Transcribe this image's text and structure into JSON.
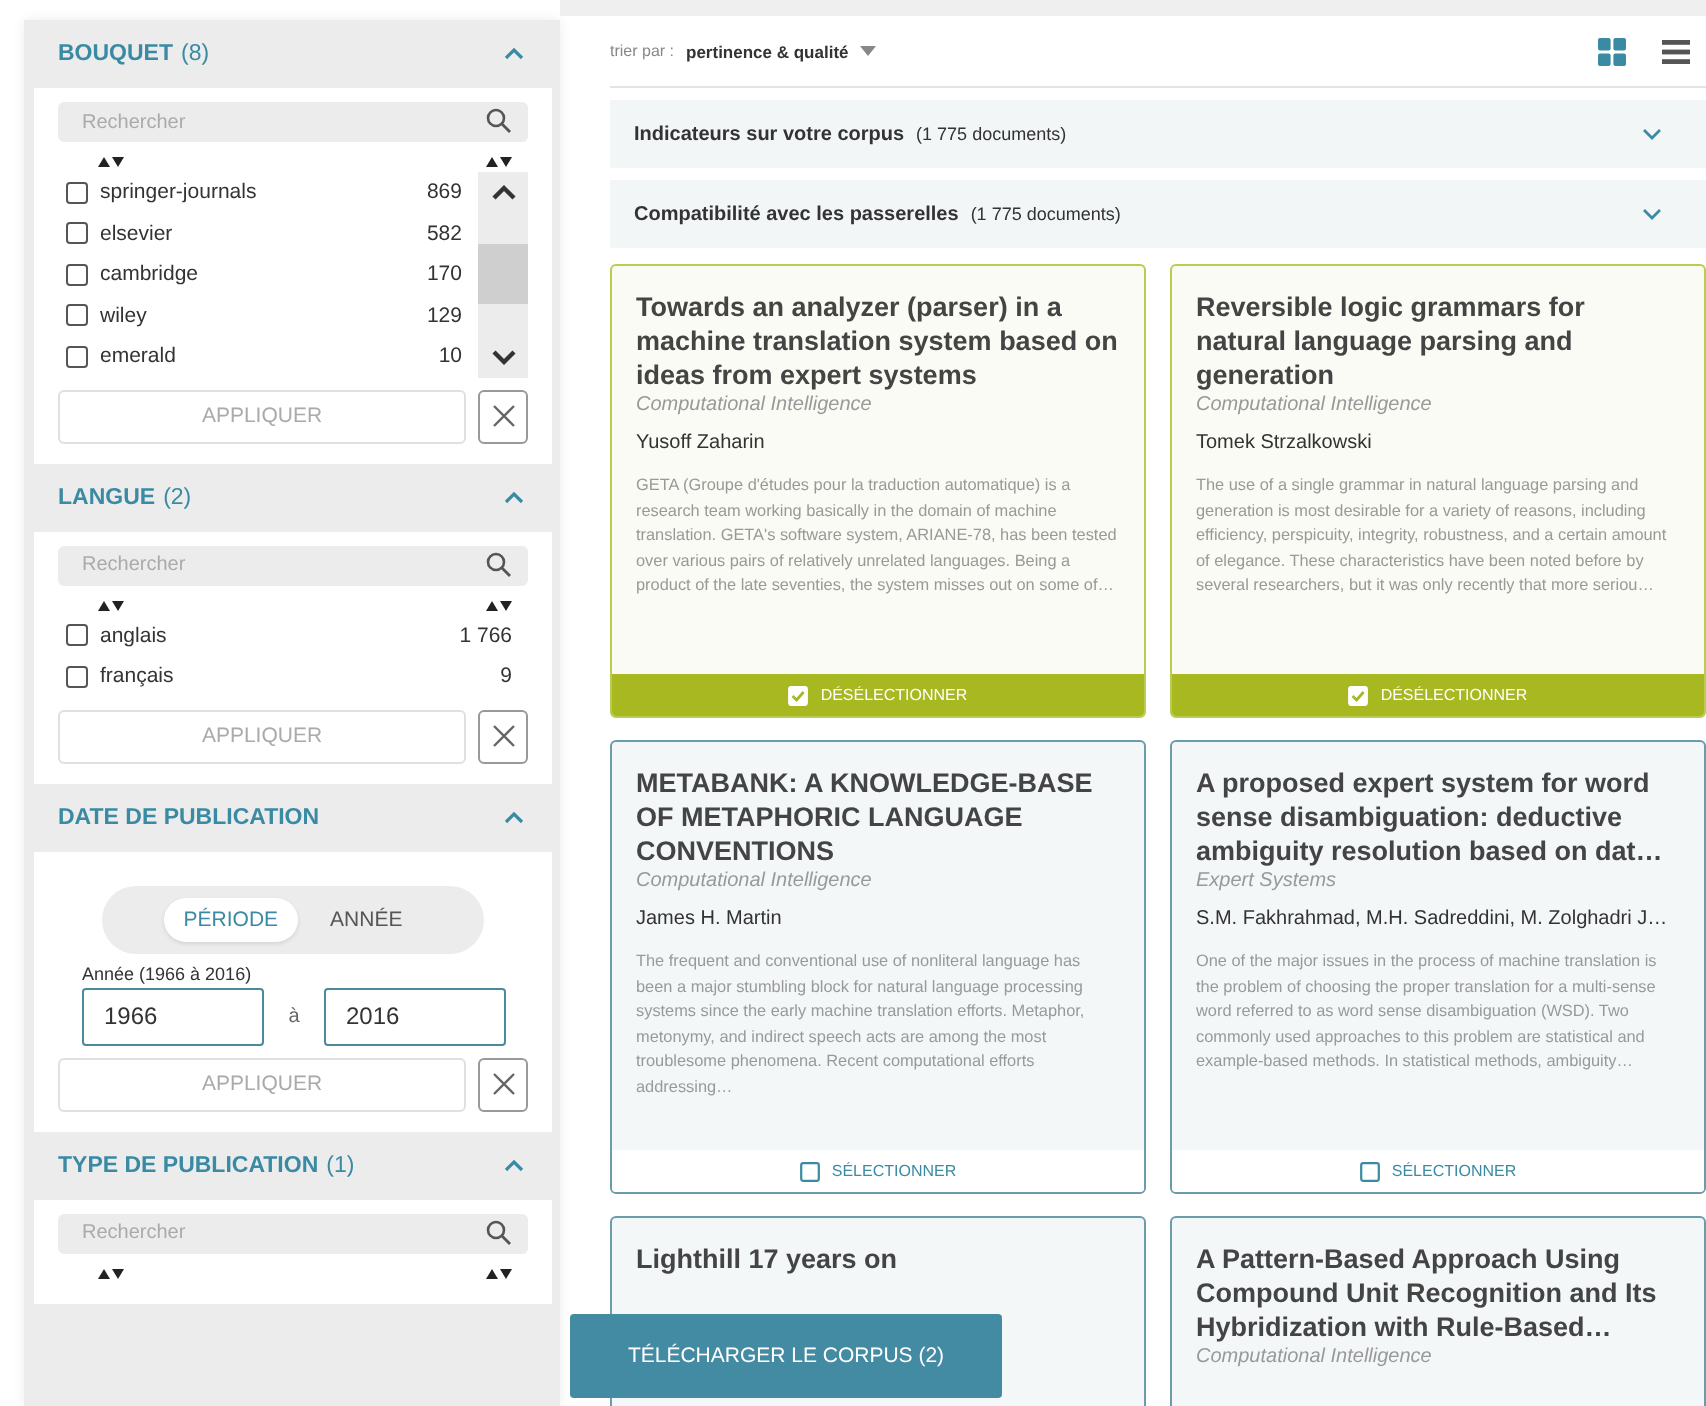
{
  "sort": {
    "label": "trier par :",
    "value": "pertinence & qualité"
  },
  "view_toggle": [
    {
      "kind": "grid",
      "selected": true
    },
    {
      "kind": "list",
      "selected": false
    }
  ],
  "panels": [
    {
      "title": "Indicateurs sur votre corpus",
      "count": "(1 775 documents)",
      "expanded": false
    },
    {
      "title": "Compatibilité avec les passerelles",
      "count": "(1 775 documents)",
      "expanded": false
    }
  ],
  "facets": [
    {
      "kind": "list",
      "title": "BOUQUET",
      "count": "(8)",
      "expanded": true,
      "search_placeholder": "Rechercher",
      "apply": "APPLIQUER",
      "items": [
        {
          "label": "springer-journals",
          "count": "869",
          "checked": false
        },
        {
          "label": "elsevier",
          "count": "582",
          "checked": false
        },
        {
          "label": "cambridge",
          "count": "170",
          "checked": false
        },
        {
          "label": "wiley",
          "count": "129",
          "checked": false
        },
        {
          "label": "emerald",
          "count": "10",
          "checked": false
        }
      ]
    },
    {
      "kind": "list",
      "title": "LANGUE",
      "count": "(2)",
      "expanded": true,
      "search_placeholder": "Rechercher",
      "apply": "APPLIQUER",
      "items": [
        {
          "label": "anglais",
          "count": "1 766",
          "checked": false
        },
        {
          "label": "français",
          "count": "9",
          "checked": false
        }
      ]
    },
    {
      "kind": "date",
      "title": "DATE DE PUBLICATION",
      "expanded": true,
      "modes": [
        {
          "label": "PÉRIODE",
          "selected": true
        },
        {
          "label": "ANNÉE",
          "selected": false
        }
      ],
      "range_label": "Année (1966 à 2016)",
      "from": "1966",
      "separator": "à",
      "to": "2016",
      "apply": "APPLIQUER"
    },
    {
      "kind": "list",
      "title": "TYPE DE PUBLICATION",
      "count": "(1)",
      "expanded": true,
      "search_placeholder": "Rechercher"
    }
  ],
  "cards": [
    {
      "title": "Towards an analyzer (parser) in a machine translation system based on ideas from expert systems",
      "journal": "Computational Intelligence",
      "authors": "Yusoff Zaharin",
      "abstract": "GETA (Groupe d'études pour la traduction automatique) is a research team working basically in the domain of machine translation. GETA's software system, ARIANE-78, has been tested over various pairs of relatively unrelated languages. Being a product of the late seventies, the system misses out on some of…",
      "selected": true,
      "action": "DÉSÉLECTIONNER"
    },
    {
      "title": "Reversible logic grammars for natural language parsing and generation",
      "journal": "Computational Intelligence",
      "authors": "Tomek Strzalkowski",
      "abstract": "The use of a single grammar in natural language parsing and generation is most desirable for a variety of reasons, including efficiency, perspicuity, integrity, robustness, and a certain amount of elegance. These characteristics have been noted before by several researchers, but it was only recently that more seriou…",
      "selected": true,
      "action": "DÉSÉLECTIONNER"
    },
    {
      "title": "METABANK: A KNOWLEDGE-BASE OF METAPHORIC LANGUAGE CONVENTIONS",
      "journal": "Computational Intelligence",
      "authors": "James H. Martin",
      "abstract": "The frequent and conventional use of nonliteral language has been a major stumbling block for natural language processing systems since the early machine translation efforts. Metaphor, metonymy, and indirect speech acts are among the most troublesome phenomena. Recent computational efforts addressing…",
      "selected": false,
      "action": "SÉLECTIONNER"
    },
    {
      "title": "A proposed expert system for word sense disambiguation: deductive ambiguity resolution based on dat…",
      "journal": "Expert Systems",
      "authors": "S.M. Fakhrahmad, M.H. Sadreddini, M. Zolghadri J…",
      "abstract": "One of the major issues in the process of machine translation is the problem of choosing the proper translation for a multi-sense word referred to as word sense disambiguation (WSD). Two commonly used approaches to this problem are statistical and example-based methods. In statistical methods, ambiguity…",
      "selected": false,
      "action": "SÉLECTIONNER"
    },
    {
      "title": "Lighthill 17 years on",
      "selected": false
    },
    {
      "title": "A Pattern-Based Approach Using Compound Unit Recognition and Its Hybridization with Rule-Based…",
      "journal": "Computational Intelligence",
      "selected": false
    }
  ],
  "download_button": "TÉLÉCHARGER LE CORPUS (2)"
}
